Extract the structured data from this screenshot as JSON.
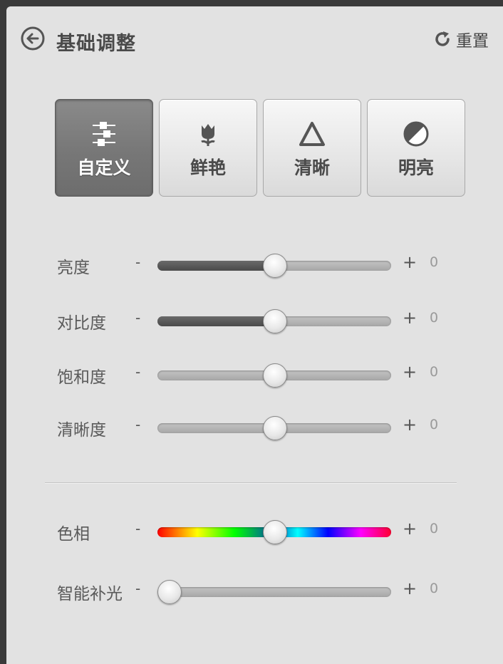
{
  "header": {
    "title": "基础调整",
    "reset_label": "重置"
  },
  "presets": [
    {
      "label": "自定义",
      "icon": "sliders-icon",
      "active": true
    },
    {
      "label": "鲜艳",
      "icon": "tulip-icon",
      "active": false
    },
    {
      "label": "清晰",
      "icon": "triangle-icon",
      "active": false
    },
    {
      "label": "明亮",
      "icon": "half-circle-icon",
      "active": false
    }
  ],
  "adjustments": [
    {
      "label": "亮度",
      "minus": "-",
      "plus": "+",
      "value": "0",
      "level": 0.5
    },
    {
      "label": "对比度",
      "minus": "-",
      "plus": "+",
      "value": "0",
      "level": 0.5
    },
    {
      "label": "饱和度",
      "minus": "-",
      "plus": "+",
      "value": "0",
      "level": 0.5
    },
    {
      "label": "清晰度",
      "minus": "-",
      "plus": "+",
      "value": "0",
      "level": 0.5
    },
    {
      "label": "色相",
      "minus": "-",
      "plus": "+",
      "value": "0",
      "level": 0.5
    },
    {
      "label": "智能补光",
      "minus": "-",
      "plus": "+",
      "value": "0",
      "level": 0.0
    }
  ],
  "colors": {
    "panel_bg": "#e2e2e2",
    "active_preset": "#777777",
    "text": "#5a5a5a"
  }
}
